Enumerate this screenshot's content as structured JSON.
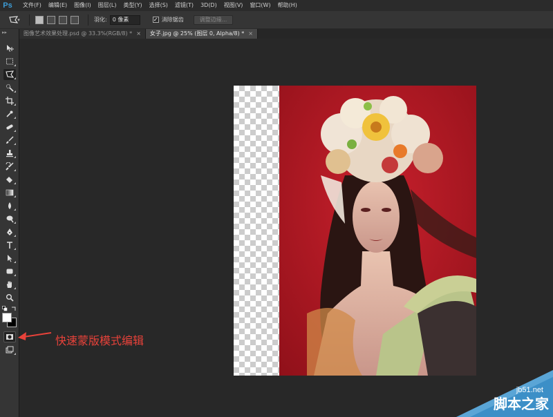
{
  "app": {
    "logo": "Ps"
  },
  "menu": [
    "文件(F)",
    "编辑(E)",
    "图像(I)",
    "图层(L)",
    "类型(Y)",
    "选择(S)",
    "滤镜(T)",
    "3D(D)",
    "视图(V)",
    "窗口(W)",
    "帮助(H)"
  ],
  "options": {
    "tool_icon": "polygonal-lasso-icon",
    "feather_label": "羽化:",
    "feather_value": "0 像素",
    "antialias_label": "消除锯齿",
    "antialias_checked": true,
    "refine_edge_label": "调整边缘..."
  },
  "tabs": [
    {
      "title": "图像艺术效果处理.psd @ 33.3%(RGB/8) *",
      "active": false
    },
    {
      "title": "女子.jpg @ 25% (图层 0, Alpha/8) *",
      "active": true
    }
  ],
  "tools": [
    "move-icon",
    "rect-marquee-icon",
    "polygonal-lasso-icon",
    "quick-select-icon",
    "crop-icon",
    "eyedropper-icon",
    "healing-brush-icon",
    "brush-icon",
    "clone-stamp-icon",
    "history-brush-icon",
    "eraser-icon",
    "gradient-icon",
    "blur-icon",
    "dodge-icon",
    "pen-icon",
    "type-icon",
    "path-select-icon",
    "rectangle-shape-icon",
    "hand-icon",
    "zoom-icon"
  ],
  "annotation": {
    "text": "快速蒙版模式编辑",
    "color": "#e8423a"
  },
  "watermark": {
    "site": "jb51.net",
    "name": "脚本之家"
  },
  "colors": {
    "foreground": "#ffffff",
    "background": "#000000",
    "photo_bg": "#b01824"
  }
}
